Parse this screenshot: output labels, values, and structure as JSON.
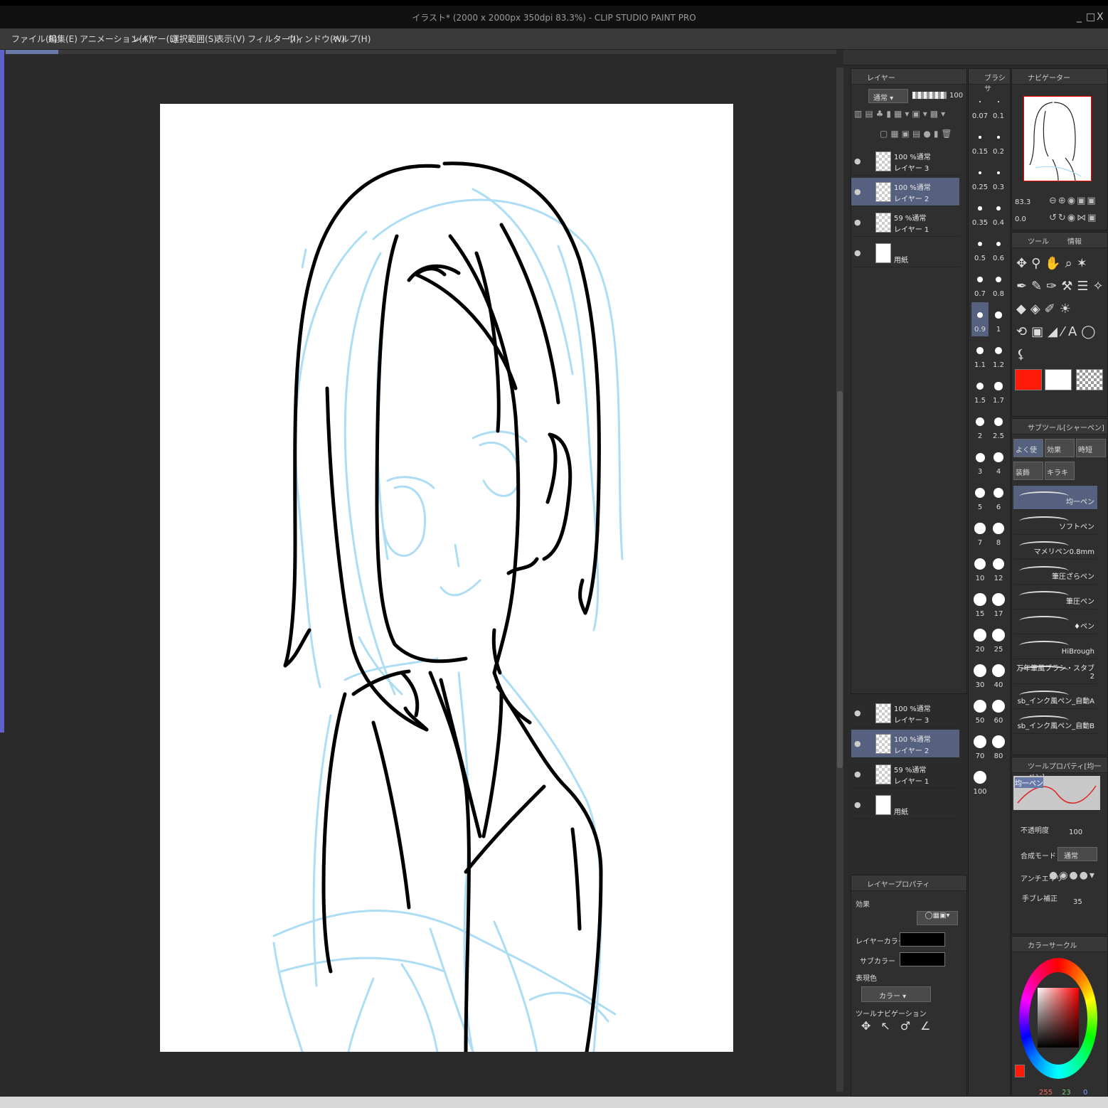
{
  "window": {
    "title": "イラスト* (2000 x 2000px 350dpi 83.3%)  - CLIP STUDIO PAINT PRO",
    "controls": [
      "_",
      "□",
      "X"
    ]
  },
  "menu": [
    "ファイル(F)",
    "編集(E)",
    "アニメーション(A)",
    "レイヤー(L)",
    "選択範囲(S)",
    "表示(V)",
    "フィルター(I)",
    "ウィンドウ(W)",
    "ヘルプ(H)"
  ],
  "layer_panel": {
    "title": "レイヤー",
    "blend_mode": "通常",
    "opacity": "100",
    "layers": [
      {
        "mode": "100 %通常",
        "name": "レイヤー 3",
        "selected": false
      },
      {
        "mode": "100 %通常",
        "name": "レイヤー 2",
        "selected": true
      },
      {
        "mode": "59 %通常",
        "name": "レイヤー 1",
        "selected": false
      },
      {
        "mode": "",
        "name": "用紙",
        "selected": false
      }
    ],
    "layers_lower": [
      {
        "mode": "100 %通常",
        "name": "レイヤー 3",
        "selected": false
      },
      {
        "mode": "100 %通常",
        "name": "レイヤー 2",
        "selected": true
      },
      {
        "mode": "59 %通常",
        "name": "レイヤー 1",
        "selected": false
      },
      {
        "mode": "",
        "name": "用紙",
        "selected": false
      }
    ]
  },
  "brush_panel": {
    "title": "ブラシサ",
    "sizes": [
      "0.07",
      "0.1",
      "0.15",
      "0.2",
      "0.25",
      "0.3",
      "0.35",
      "0.4",
      "0.5",
      "0.6",
      "0.7",
      "0.8",
      "0.9",
      "1",
      "1.1",
      "1.2",
      "1.5",
      "1.7",
      "2",
      "2.5",
      "3",
      "4",
      "5",
      "6",
      "7",
      "8",
      "10",
      "12",
      "15",
      "17",
      "20",
      "25",
      "30",
      "40",
      "50",
      "60",
      "70",
      "80",
      "100"
    ],
    "selected": "0.9"
  },
  "navigator": {
    "title": "ナビゲーター",
    "zoom": "83.3",
    "angle": "0.0"
  },
  "tool_panel": {
    "title": "ツール",
    "info_tab": "情報",
    "colors": {
      "main": "#ff1a0a",
      "sub": "#ffffff"
    }
  },
  "sub_tool": {
    "title": "サブツール[シャーペン]",
    "tabs": [
      "よく使",
      "効果",
      "時短",
      "装飾",
      "キラキ"
    ],
    "items": [
      {
        "name": "均一ペン",
        "selected": true
      },
      {
        "name": "ソフトペン",
        "selected": false
      },
      {
        "name": "マメリペン0.8mm",
        "selected": false
      },
      {
        "name": "筆圧ざらペン",
        "selected": false
      },
      {
        "name": "筆圧ペン",
        "selected": false
      },
      {
        "name": "♦ペン",
        "selected": false
      },
      {
        "name": "HiBrough",
        "selected": false
      },
      {
        "name": "万年筆風ブラシ・スタブ 2",
        "selected": false
      },
      {
        "name": "sb_インク風ペン_自動A",
        "selected": false
      },
      {
        "name": "sb_インク風ペン_自動B",
        "selected": false
      }
    ]
  },
  "tool_property": {
    "title": "ツールプロパティ[均一ペン]",
    "preview_label": "均一ペン",
    "opacity_label": "不透明度",
    "opacity_value": "100",
    "blend_label": "合成モード",
    "blend_value": "通常",
    "antialias_label": "アンチエイリ",
    "stabilization_label": "手ブレ補正",
    "stabilization_value": "35"
  },
  "layer_property": {
    "title": "レイヤープロパティ",
    "effect_label": "効果",
    "layer_color_label": "レイヤーカラー",
    "sub_color_label": "サブカラー",
    "expression_label": "表現色",
    "expression_value": "カラー",
    "tool_nav_label": "ツールナビゲーション"
  },
  "color_circle": {
    "title": "カラーサークル",
    "r": "255",
    "g": "23",
    "b": "0"
  }
}
